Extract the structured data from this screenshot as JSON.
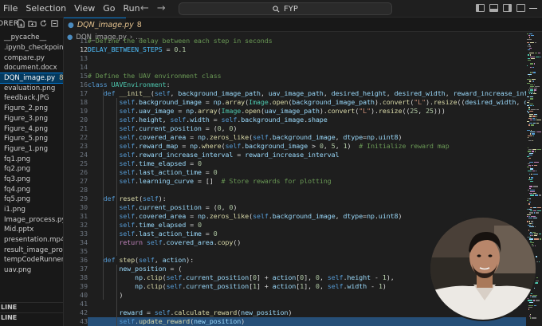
{
  "menu": [
    "File",
    "Selection",
    "View",
    "Go",
    "Run"
  ],
  "search_label": "FYP",
  "explorer": {
    "title": "ORER",
    "files": [
      {
        "name": "__pycache__"
      },
      {
        "name": ".ipynb_checkpoints"
      },
      {
        "name": "compare.py"
      },
      {
        "name": "document.docx"
      },
      {
        "name": "DQN_image.py",
        "badge": "8",
        "active": true
      },
      {
        "name": "evaluation.png"
      },
      {
        "name": "feedback.JPG"
      },
      {
        "name": "Figure_2.png"
      },
      {
        "name": "Figure_3.png"
      },
      {
        "name": "Figure_4.png"
      },
      {
        "name": "Figure_5.png"
      },
      {
        "name": "Figure_1.png"
      },
      {
        "name": "fq1.png"
      },
      {
        "name": "fq2.png"
      },
      {
        "name": "fq3.png"
      },
      {
        "name": "fq4.png"
      },
      {
        "name": "fq5.png"
      },
      {
        "name": "i1.png"
      },
      {
        "name": "Image_process.py"
      },
      {
        "name": "Mid.pptx"
      },
      {
        "name": "presentation.mp4"
      },
      {
        "name": "result_image_proc..."
      },
      {
        "name": "tempCodeRunner..."
      },
      {
        "name": "uav.png"
      }
    ],
    "footer": [
      "LINE",
      "LINE"
    ]
  },
  "tab": {
    "label": "DQN_image.py",
    "count": "8"
  },
  "breadcrumb": [
    "DQN_image.py",
    "..."
  ],
  "code_lines": [
    {
      "n": "11",
      "text": "# Define the delay between each step in seconds"
    },
    {
      "n": "12",
      "text": "DELAY_BETWEEN_STEPS = 0.1",
      "current": true
    },
    {
      "n": "13",
      "text": ""
    },
    {
      "n": "14",
      "text": ""
    },
    {
      "n": "15",
      "text": "# Define the UAV environment class"
    },
    {
      "n": "16",
      "text": "class UAVEnvironment:"
    },
    {
      "n": "17",
      "text": "    def __init__(self, background_image_path, uav_image_path, desired_height, desired_width, reward_increase_interval):"
    },
    {
      "n": "18",
      "text": "        self.background_image = np.array(Image.open(background_image_path).convert(\"L\").resize((desired_width, desired_height"
    },
    {
      "n": "19",
      "text": "        self.uav_image = np.array(Image.open(uav_image_path).convert(\"L\").resize((25, 25)))"
    },
    {
      "n": "20",
      "text": "        self.height, self.width = self.background_image.shape"
    },
    {
      "n": "21",
      "text": "        self.current_position = (0, 0)"
    },
    {
      "n": "22",
      "text": "        self.covered_area = np.zeros_like(self.background_image, dtype=np.uint8)"
    },
    {
      "n": "23",
      "text": "        self.reward_map = np.where(self.background_image > 0, 5, 1)  # Initialize reward map"
    },
    {
      "n": "24",
      "text": "        self.reward_increase_interval = reward_increase_interval"
    },
    {
      "n": "25",
      "text": "        self.time_elapsed = 0"
    },
    {
      "n": "26",
      "text": "        self.last_action_time = 0"
    },
    {
      "n": "27",
      "text": "        self.learning_curve = []  # Store rewards for plotting"
    },
    {
      "n": "28",
      "text": ""
    },
    {
      "n": "29",
      "text": "    def reset(self):"
    },
    {
      "n": "30",
      "text": "        self.current_position = (0, 0)"
    },
    {
      "n": "31",
      "text": "        self.covered_area = np.zeros_like(self.background_image, dtype=np.uint8)"
    },
    {
      "n": "32",
      "text": "        self.time_elapsed = 0"
    },
    {
      "n": "33",
      "text": "        self.last_action_time = 0"
    },
    {
      "n": "34",
      "text": "        return self.covered_area.copy()"
    },
    {
      "n": "35",
      "text": ""
    },
    {
      "n": "36",
      "text": "    def step(self, action):"
    },
    {
      "n": "37",
      "text": "        new_position = ("
    },
    {
      "n": "38",
      "text": "            np.clip(self.current_position[0] + action[0], 0, self.height - 1),"
    },
    {
      "n": "39",
      "text": "            np.clip(self.current_position[1] + action[1], 0, self.width - 1)"
    },
    {
      "n": "40",
      "text": "        )"
    },
    {
      "n": "41",
      "text": ""
    },
    {
      "n": "42",
      "text": "        reward = self.calculate_reward(new_position)"
    },
    {
      "n": "43",
      "text": "        self.update_reward(new_position)",
      "highlight": true
    }
  ],
  "colors": {
    "keyword": "#569cd6",
    "control": "#c586c0",
    "function": "#dcdcaa",
    "class": "#4ec9b0",
    "string": "#ce9178",
    "number": "#b5cea8",
    "comment": "#6a9955",
    "variable": "#9cdcfe",
    "constant": "#4fc1ff",
    "text": "#d4d4d4"
  }
}
